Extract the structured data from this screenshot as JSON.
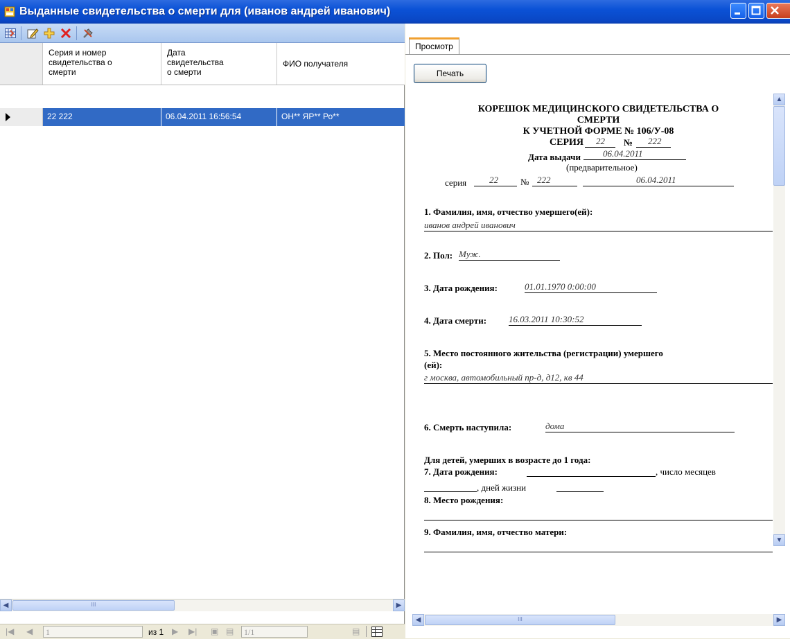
{
  "window": {
    "title": "Выданные свидетельства о смерти для  (иванов андрей иванович)"
  },
  "grid": {
    "headers": [
      "Серия и номер\nсвидетельства о\nсмерти",
      "Дата\nсвидетельства\nо смерти",
      "ФИО получателя"
    ],
    "header_lines": [
      [
        "Серия и номер",
        "свидетельства о",
        "смерти"
      ],
      [
        "Дата",
        "свидетельства",
        "о смерти"
      ]
    ],
    "header3": "ФИО получателя",
    "rows": [
      {
        "series": "22 222",
        "date": "06.04.2011 16:56:54",
        "fio": "ОН** ЯР** Ро**"
      }
    ]
  },
  "scroll": {
    "thumb": "III"
  },
  "navigator": {
    "position": "1",
    "of_label": "из 1",
    "page": "1/1"
  },
  "preview": {
    "tab": "Просмотр",
    "print_button": "Печать"
  },
  "document": {
    "heading1": "КОРЕШОК МЕДИЦИНСКОГО СВИДЕТЕЛЬСТВА О",
    "heading2": "СМЕРТИ",
    "heading3": "К УЧЕТНОЙ ФОРМЕ № 106/У-08",
    "series_label": "СЕРИЯ",
    "series_value": "22",
    "number_label": "№",
    "number_value": "222",
    "issue_label": "Дата выдачи",
    "issue_value": "06.04.2011",
    "prelim": "(предварительное)",
    "series2_label": "серия",
    "series2_value": "22",
    "number2_label": "№",
    "number2_value": "222",
    "date2_value": "06.04.2011",
    "q1": "1. Фамилия, имя, отчество умершего(ей):",
    "q1_value": "иванов андрей иванович",
    "q2": "2. Пол:",
    "q2_value": "Муж.",
    "q3": "3. Дата рождения:",
    "q3_value": "01.01.1970 0:00:00",
    "q4": "4. Дата смерти:",
    "q4_value": "16.03.2011 10:30:52",
    "q5a": "5. Место постоянного жительства (регистрации) умершего",
    "q5b": "(ей):",
    "q5_value": "г москва, автомобильный пр-д, д12, кв 44",
    "q6": "6. Смерть наступила:",
    "q6_value": "дома",
    "children": "Для детей, умерших в возрасте до 1 года:",
    "q7": "7. Дата рождения:",
    "q7_months": ", число месяцев",
    "q7_days": ", дней жизни",
    "q8": "8. Место рождения:",
    "q9": "9. Фамилия, имя, отчество матери:"
  }
}
